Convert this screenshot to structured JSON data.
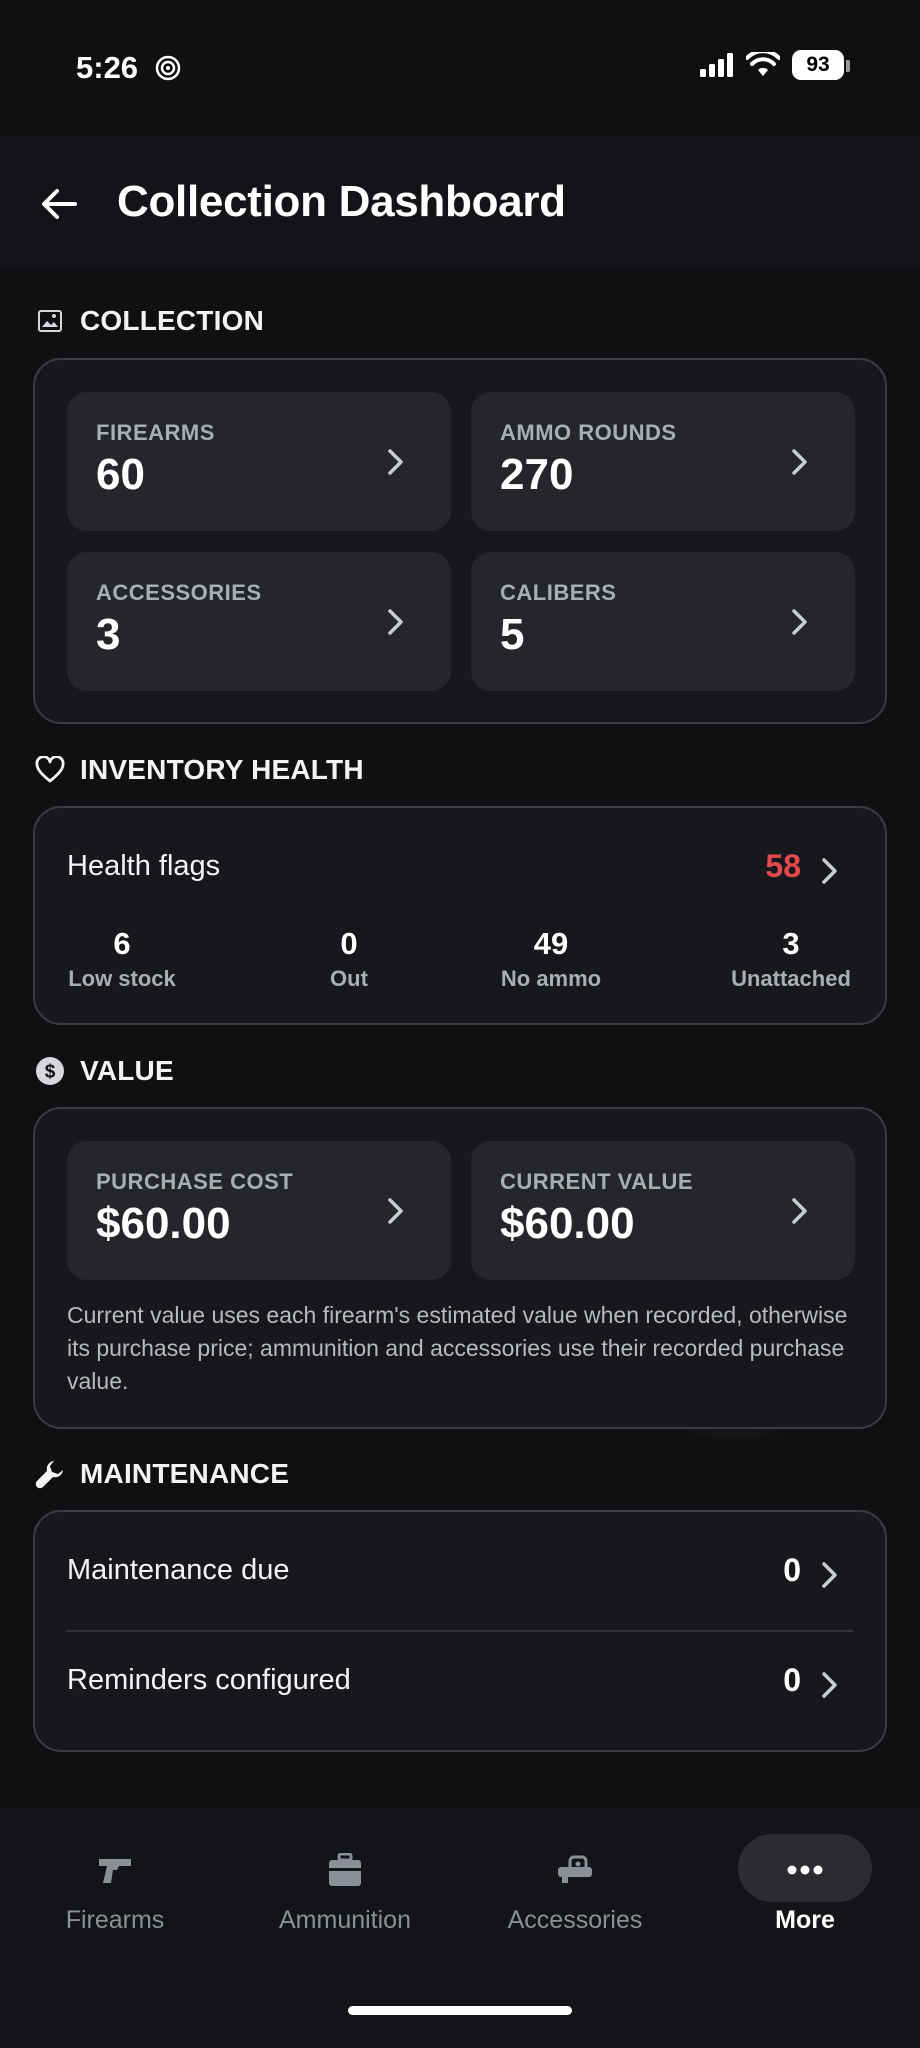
{
  "status_bar": {
    "time": "5:26",
    "battery": "93"
  },
  "header": {
    "title": "Collection Dashboard"
  },
  "collection": {
    "heading": "COLLECTION",
    "tiles": [
      {
        "label": "FIREARMS",
        "value": "60"
      },
      {
        "label": "AMMO ROUNDS",
        "value": "270"
      },
      {
        "label": "ACCESSORIES",
        "value": "3"
      },
      {
        "label": "CALIBERS",
        "value": "5"
      }
    ]
  },
  "inventory_health": {
    "heading": "INVENTORY HEALTH",
    "title": "Health flags",
    "count": "58",
    "metrics": [
      {
        "value": "6",
        "label": "Low stock"
      },
      {
        "value": "0",
        "label": "Out"
      },
      {
        "value": "49",
        "label": "No ammo"
      },
      {
        "value": "3",
        "label": "Unattached"
      }
    ]
  },
  "value": {
    "heading": "VALUE",
    "tiles": [
      {
        "label": "PURCHASE COST",
        "value": "$60.00"
      },
      {
        "label": "CURRENT VALUE",
        "value": "$60.00"
      }
    ],
    "note": "Current value uses each firearm's estimated value when recorded, otherwise its purchase price; ammunition and accessories use their recorded purchase value."
  },
  "maintenance": {
    "heading": "MAINTENANCE",
    "rows": [
      {
        "label": "Maintenance due",
        "value": "0"
      },
      {
        "label": "Reminders configured",
        "value": "0"
      }
    ]
  },
  "bottom_nav": {
    "items": [
      {
        "label": "Firearms",
        "icon": "pistol-icon"
      },
      {
        "label": "Ammunition",
        "icon": "ammo-box-icon"
      },
      {
        "label": "Accessories",
        "icon": "scope-icon"
      },
      {
        "label": "More",
        "icon": "more-dots-icon"
      }
    ],
    "active": "More"
  },
  "colors": {
    "background": "#0f1012",
    "panel": "#17181b",
    "tile": "#24262a",
    "alert": "#e5484d",
    "muted": "#a9adb5"
  }
}
